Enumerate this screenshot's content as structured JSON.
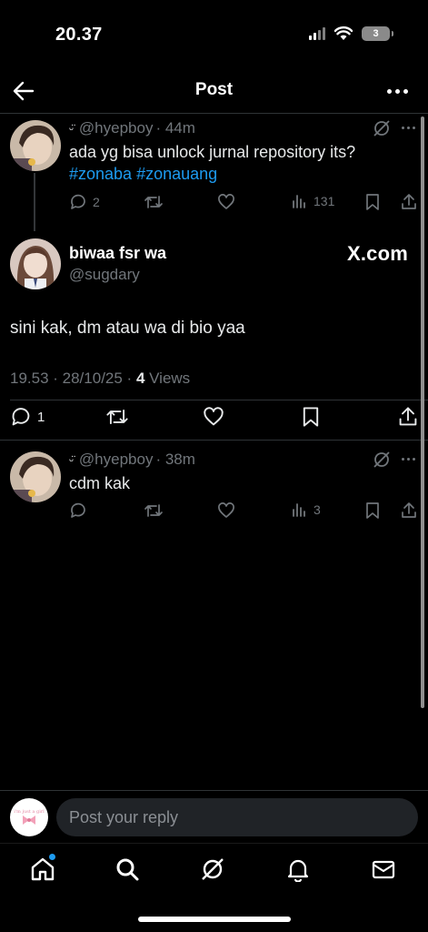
{
  "status_bar": {
    "time": "20.37",
    "battery": "3"
  },
  "header": {
    "title": "Post"
  },
  "reply_1": {
    "emoji": "ᵕ̈",
    "handle": "@hyepboy",
    "time": "· 44m",
    "text": "ada yg bisa unlock jurnal repository its?",
    "hashtags": "#zonaba #zonauang",
    "replies": "2",
    "views": "131"
  },
  "main_post": {
    "name": "biwaa fsr wa",
    "handle": "@sugdary",
    "badge": "X.com",
    "text": "sini kak, dm atau wa di bio yaa",
    "timestamp": "19.53 · 28/10/25 · ",
    "views_count": "4",
    "views_label": " Views",
    "replies": "1"
  },
  "reply_2": {
    "emoji": "ᵕ̈",
    "handle": "@hyepboy",
    "time": "· 38m",
    "text": "cdm kak",
    "views": "3"
  },
  "reply_bar": {
    "placeholder": "Post your reply",
    "avatar_text": "i'm just a girl"
  },
  "colors": {
    "accent": "#1d9bf0",
    "muted": "#71767b",
    "background": "#000000"
  }
}
